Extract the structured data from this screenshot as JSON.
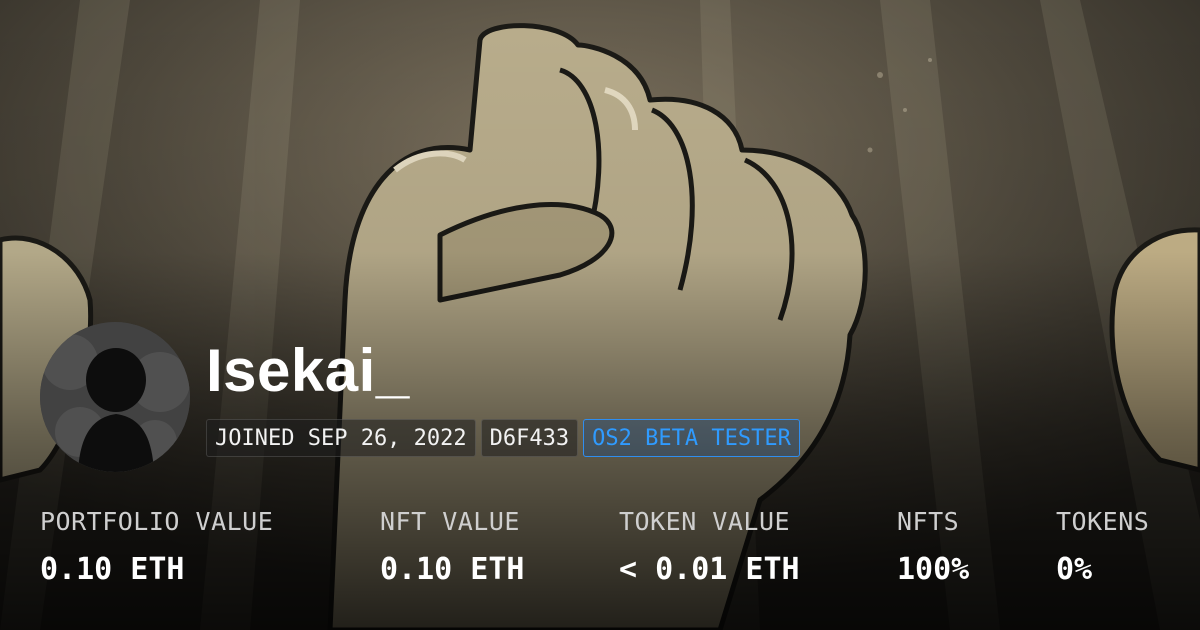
{
  "profile": {
    "username": "Isekai_",
    "avatar_icon": "user-silhouette-icon"
  },
  "badges": {
    "joined": "JOINED SEP 26, 2022",
    "address": "D6F433",
    "beta": "OS2 BETA TESTER"
  },
  "stats": [
    {
      "label": "PORTFOLIO VALUE",
      "value": "0.10 ETH"
    },
    {
      "label": "NFT VALUE",
      "value": "0.10 ETH"
    },
    {
      "label": "TOKEN VALUE",
      "value": "< 0.01 ETH"
    },
    {
      "label": "NFTS",
      "value": "100%"
    },
    {
      "label": "TOKENS",
      "value": "0%"
    }
  ],
  "colors": {
    "accent_blue": "#2f9bff",
    "text_white": "#ffffff",
    "label_gray": "#cfcfcf"
  }
}
